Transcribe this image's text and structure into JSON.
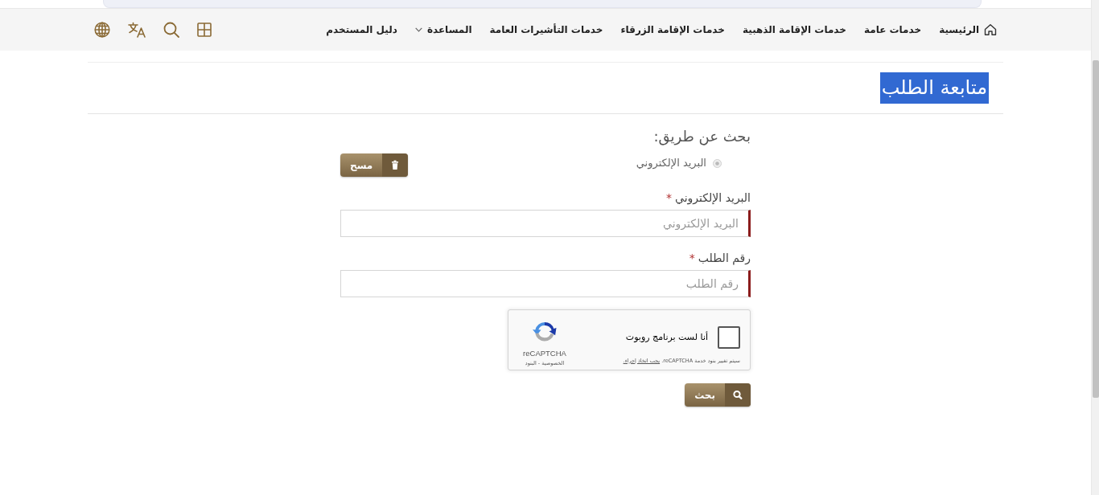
{
  "navbar": {
    "items": [
      {
        "label": "الرئيسية",
        "kind": "home"
      },
      {
        "label": "خدمات عامة",
        "kind": "link"
      },
      {
        "label": "خدمات الإقامة الذهبية",
        "kind": "link"
      },
      {
        "label": "خدمات الإقامة الزرقاء",
        "kind": "link"
      },
      {
        "label": "خدمات التأشيرات العامة",
        "kind": "link"
      },
      {
        "label": "المساعدة",
        "kind": "dropdown"
      },
      {
        "label": "دليل المستخدم",
        "kind": "link"
      }
    ]
  },
  "page": {
    "title": "متابعة الطلب",
    "title_highlighted": true
  },
  "search_by": {
    "heading": "بحث عن طريق:",
    "options": [
      {
        "label": "البريد الإلكتروني",
        "selected": true,
        "disabled": true
      }
    ],
    "clear_button": "مسح"
  },
  "fields": [
    {
      "label": "البريد الإلكتروني",
      "required": true,
      "required_mark": "*",
      "placeholder": "البريد الإلكتروني"
    },
    {
      "label": "رقم الطلب",
      "required": true,
      "required_mark": "*",
      "placeholder": "رقم الطلب"
    }
  ],
  "captcha": {
    "label": "أنا لست برنامج روبوت",
    "checked": false,
    "brand": "reCAPTCHA",
    "terms": "الخصوصية - البنود",
    "notice": "سيتم تغيير بنود خدمة reCAPTCHA.",
    "notice_link": "يجب اتخاذ إجراء."
  },
  "search_button": "بحث"
}
